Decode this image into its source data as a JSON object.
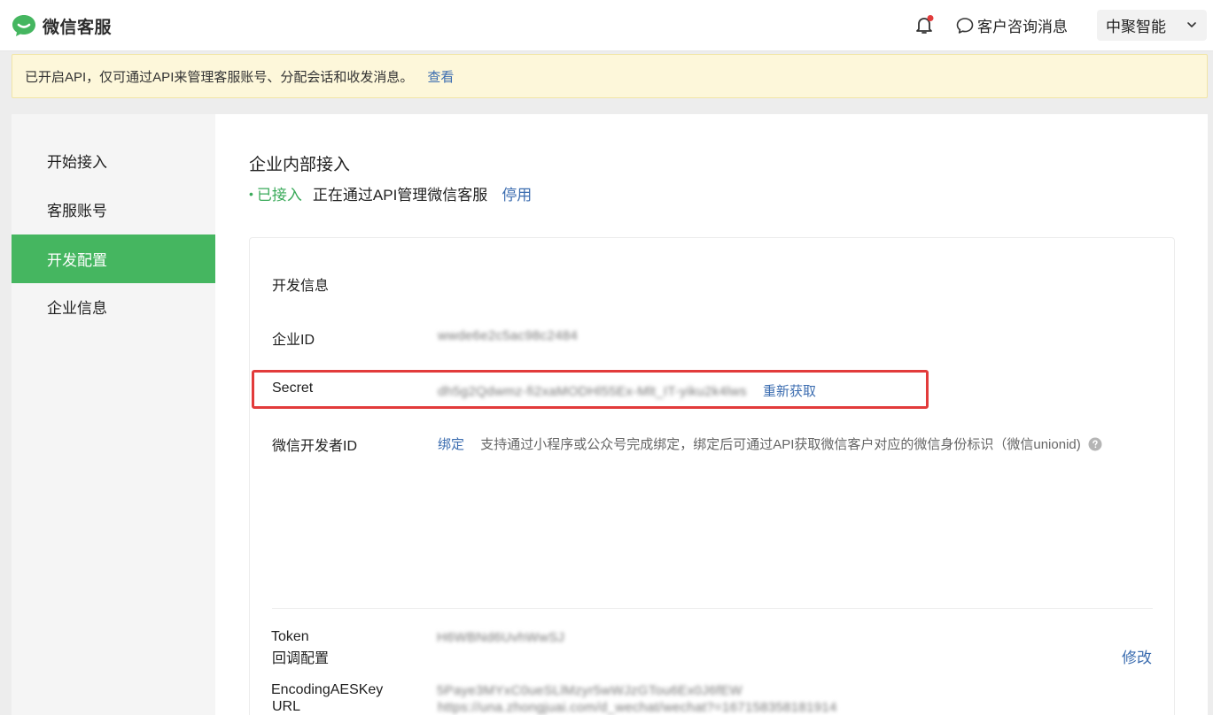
{
  "header": {
    "app_title": "微信客服",
    "messages_label": "客户咨询消息",
    "org_name": "中聚智能",
    "brand_color": "#45b660",
    "notification_dot_color": "#e23b3b"
  },
  "notice": {
    "text": "已开启API，仅可通过API来管理客服账号、分配会话和收发消息。",
    "link": "查看"
  },
  "sidebar": {
    "items": [
      {
        "label": "开始接入",
        "active": false
      },
      {
        "label": "客服账号",
        "active": false
      },
      {
        "label": "开发配置",
        "active": true
      },
      {
        "label": "企业信息",
        "active": false
      }
    ]
  },
  "main": {
    "title": "企业内部接入",
    "status_connected": "已接入",
    "status_text": "正在通过API管理微信客服",
    "status_action": "停用",
    "dev_info": {
      "heading": "开发信息",
      "corp_id_label": "企业ID",
      "corp_id_value": "wwde6e2c5ac98c2484",
      "secret_label": "Secret",
      "secret_value": "dh5g2Qdwmz-fi2xaMODHl55Ex-Mlt_IT-yiku2k4lws",
      "secret_action": "重新获取",
      "dev_id_label": "微信开发者ID",
      "dev_id_action": "绑定",
      "dev_id_desc": "支持通过小程序或公众号完成绑定，绑定后可通过API获取微信客户对应的微信身份标识（微信unionid)"
    },
    "callback": {
      "heading": "回调配置",
      "edit_label": "修改",
      "url_label": "URL",
      "url_value": "https://una.zhongjuai.com/d_wechat/wechat?=167158358181914",
      "token_label": "Token",
      "token_value": "H6WBNd6UvhWwSJ",
      "aes_label": "EncodingAESKey",
      "aes_value": "5Paye3MYxC0ueSLlMzyr5wWJzGTou6Ex0J6fEW"
    }
  }
}
